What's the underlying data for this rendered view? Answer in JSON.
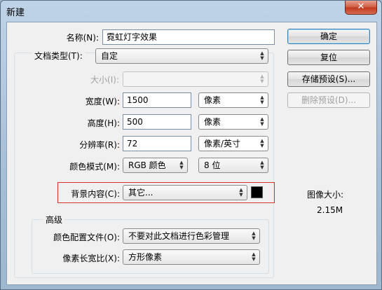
{
  "window": {
    "title": "新建",
    "close_symbol": "✕"
  },
  "form": {
    "name": {
      "label": "名称(N):",
      "value": "霓虹灯字效果"
    },
    "preset": {
      "label": "文档类型(T):",
      "value": "自定"
    },
    "size": {
      "label": "大小(I):",
      "value": ""
    },
    "width": {
      "label": "宽度(W):",
      "value": "1500",
      "unit": "像素"
    },
    "height": {
      "label": "高度(H):",
      "value": "500",
      "unit": "像素"
    },
    "resolution": {
      "label": "分辨率(R):",
      "value": "72",
      "unit": "像素/英寸"
    },
    "color_mode": {
      "label": "颜色模式(M):",
      "value": "RGB 颜色",
      "depth": "8 位"
    },
    "background": {
      "label": "背景内容(C):",
      "value": "其它...",
      "swatch_color": "#000000"
    },
    "advanced": {
      "title": "高级",
      "color_profile": {
        "label": "颜色配置文件(O):",
        "value": "不要对此文档进行色彩管理"
      },
      "pixel_aspect": {
        "label": "像素长宽比(X):",
        "value": "方形像素"
      }
    }
  },
  "buttons": {
    "ok": "确定",
    "reset": "复位",
    "save_preset": "存储预设(S)...",
    "delete_preset": "删除预设(D)..."
  },
  "image_size": {
    "label": "图像大小:",
    "value": "2.15M"
  },
  "colors": {
    "highlight": "#d9342b"
  }
}
